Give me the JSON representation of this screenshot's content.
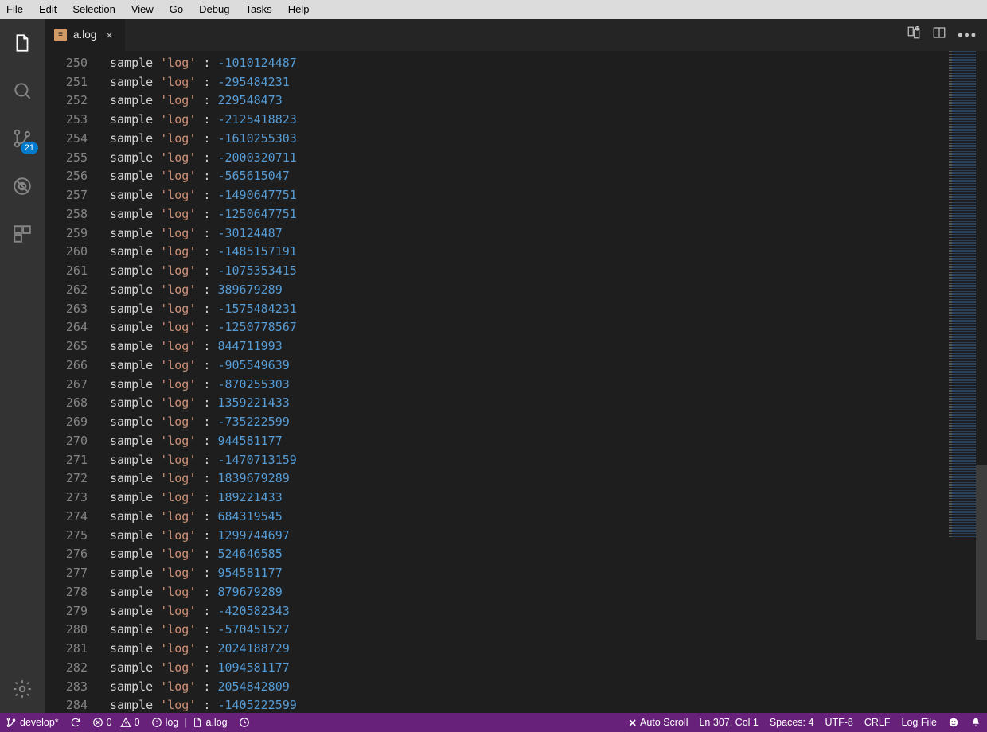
{
  "menubar": [
    "File",
    "Edit",
    "Selection",
    "View",
    "Go",
    "Debug",
    "Tasks",
    "Help"
  ],
  "tab": {
    "filename": "a.log",
    "icon_letter": "≡"
  },
  "scm_badge": "21",
  "editor": {
    "first_line_no": 250,
    "label": "sample",
    "tag": "'log'",
    "values": [
      -1010124487,
      -295484231,
      229548473,
      -2125418823,
      -1610255303,
      -2000320711,
      -565615047,
      -1490647751,
      -1250647751,
      -30124487,
      -1485157191,
      -1075353415,
      389679289,
      -1575484231,
      -1250778567,
      844711993,
      -905549639,
      -870255303,
      1359221433,
      -735222599,
      944581177,
      -1470713159,
      1839679289,
      189221433,
      684319545,
      1299744697,
      524646585,
      954581177,
      879679289,
      -420582343,
      -570451527,
      2024188729,
      1094581177,
      2054842809,
      -1405222599
    ]
  },
  "status": {
    "branch": "develop*",
    "errors": "0",
    "warnings": "0",
    "output_label": "log",
    "output_file": "a.log",
    "autoscroll": "Auto Scroll",
    "pos": "Ln 307, Col 1",
    "spaces": "Spaces: 4",
    "encoding": "UTF-8",
    "eol": "CRLF",
    "lang": "Log File"
  }
}
